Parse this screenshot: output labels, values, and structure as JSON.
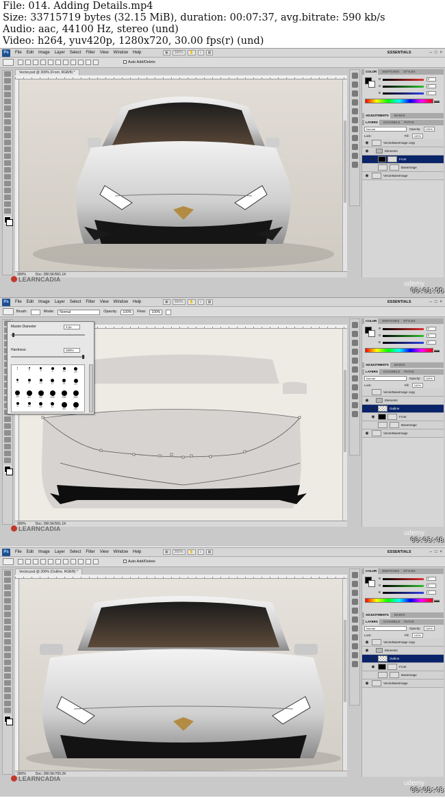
{
  "file_info": [
    "File: 014. Adding Details.mp4",
    "Size: 33715719 bytes (32.15 MiB), duration: 00:07:37, avg.bitrate: 590 kb/s",
    "Audio: aac, 44100 Hz, stereo (und)",
    "Video: h264, yuv420p, 1280x720, 30.00 fps(r) (und)"
  ],
  "app": {
    "logo": "Ps",
    "menu": [
      "File",
      "Edit",
      "Image",
      "Layer",
      "Select",
      "Filter",
      "View",
      "Window",
      "Help"
    ],
    "zoom": "300%",
    "workspace": "ESSENTIALS",
    "window_controls": [
      "–",
      "□",
      "×"
    ],
    "learncadia": "LEARNCADIA",
    "udemy": "udemy"
  },
  "frames": [
    {
      "timestamp": "00:01:55",
      "doc_tab": "Vector.psd @ 300% (Front, RGB/8) *",
      "auto_add": "Auto Add/Delete",
      "status_zoom": "300%",
      "status_doc": "Doc: 280.5K/561.1K",
      "selected_layer": "Front"
    },
    {
      "timestamp": "00:03:48",
      "brush_label": "Brush:",
      "mode_label": "Mode:",
      "mode_value": "Normal",
      "opacity_label": "Opacity:",
      "opacity_value": "100%",
      "flow_label": "Flow:",
      "flow_value": "100%",
      "master_diameter_label": "Master Diameter",
      "master_diameter_value": "3 px",
      "hardness_label": "Hardness:",
      "hardness_value": "100%",
      "brush_sizes": [
        "1",
        "3",
        "5",
        "9",
        "13",
        "19",
        "5",
        "9",
        "13",
        "17",
        "21",
        "27",
        "35",
        "45",
        "65",
        "100",
        "200",
        "300",
        "9",
        "13",
        "19",
        "17",
        "45",
        "65"
      ],
      "status_zoom": "300%",
      "status_doc": "Doc: 280.5K/561.1K",
      "selected_layer": "Outline"
    },
    {
      "timestamp": "00:05:43",
      "doc_tab": "Vector.psd @ 300% (Outline, RGB/8) *",
      "auto_add": "Auto Add/Delete",
      "status_zoom": "300%",
      "status_doc": "Doc: 280.5K/705.2K",
      "selected_layer": "Outline"
    }
  ],
  "panels": {
    "color_tabs": [
      "COLOR",
      "SWATCHES",
      "STYLES"
    ],
    "channels": [
      {
        "label": "R",
        "value": "0",
        "color": "#e03030"
      },
      {
        "label": "G",
        "value": "0",
        "color": "#30c030"
      },
      {
        "label": "B",
        "value": "0",
        "color": "#3040e0"
      }
    ],
    "adjust_tabs": [
      "ADJUSTMENTS",
      "MASKS"
    ],
    "layer_tabs": [
      "LAYERS",
      "CHANNELS",
      "PATHS"
    ],
    "blend_mode": "Normal",
    "opacity_label": "Opacity:",
    "opacity_value": "100%",
    "lock_label": "Lock:",
    "fill_label": "Fill:",
    "fill_value": "100%",
    "layers_frame1": [
      "VectorBaseImage copy",
      "Elements",
      "Front",
      "BaseImage",
      "VectorBaseImage"
    ],
    "layers_frame23": [
      "VectorBaseImage copy",
      "Elements",
      "Outline",
      "Front",
      "BaseImage",
      "VectorBaseImage"
    ]
  },
  "colors": {
    "selected_layer": "#0a246a",
    "chrome": "#c9c9c9",
    "car_body": "#d6d6d6",
    "car_shadow": "#151515"
  }
}
